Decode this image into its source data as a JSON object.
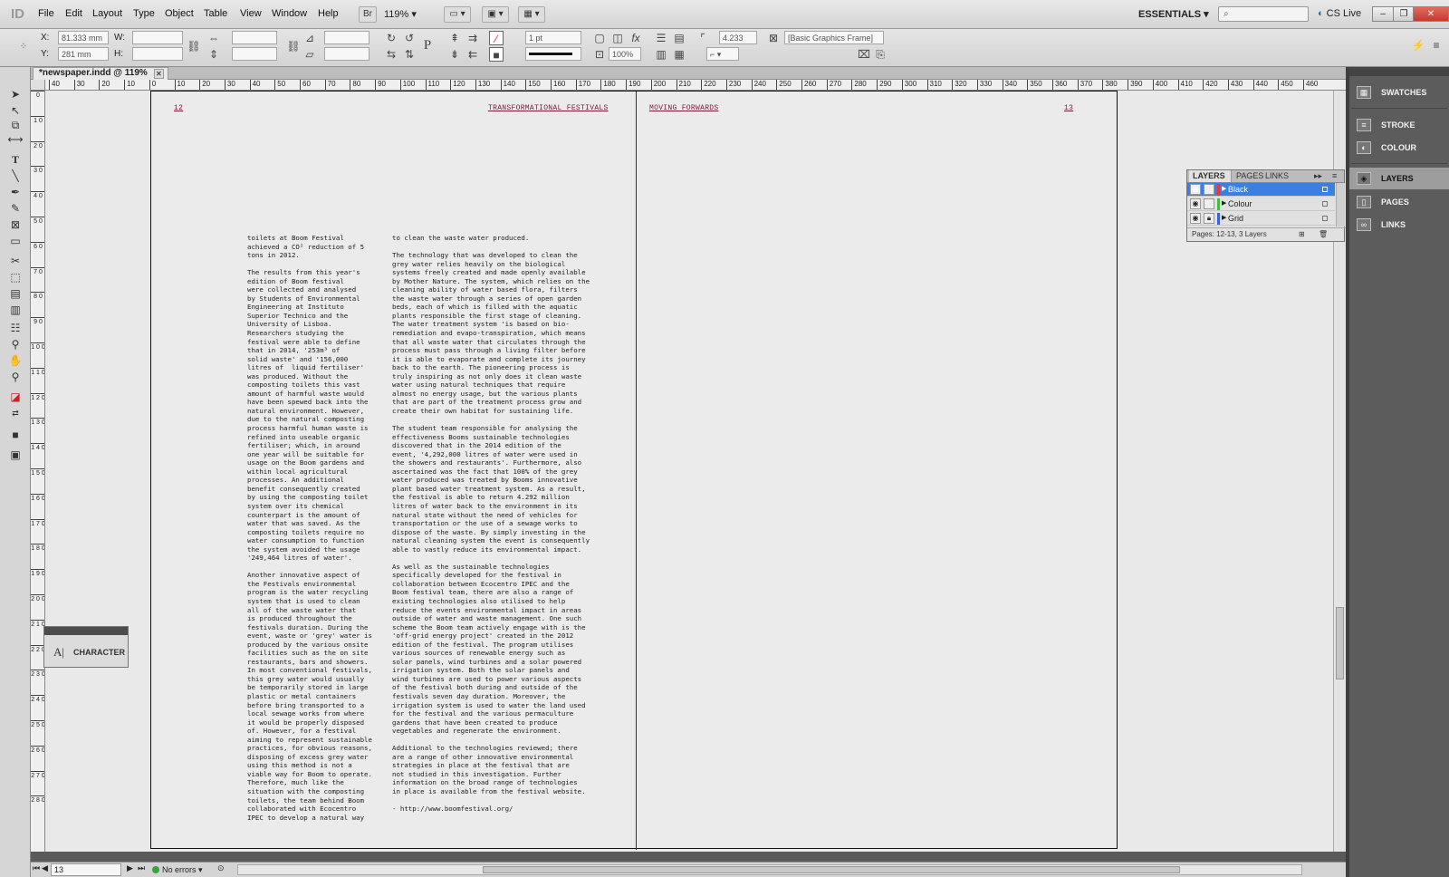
{
  "app": {
    "logo": "ID"
  },
  "menu": {
    "items": [
      "File",
      "Edit",
      "Layout",
      "Type",
      "Object",
      "Table",
      "View",
      "Window",
      "Help"
    ],
    "bridge_label": "Br",
    "zoom": "119%",
    "workspace": "ESSENTIALS",
    "cslive": "CS Live"
  },
  "control": {
    "x_label": "X:",
    "x_value": "81.333 mm",
    "y_label": "Y:",
    "y_value": "281 mm",
    "w_label": "W:",
    "h_label": "H:",
    "stroke_weight": "1 pt",
    "opacity": "100%",
    "ref_value": "4.233 mm",
    "object_style": "[Basic Graphics Frame]"
  },
  "document": {
    "tab_title": "*newspaper.indd @ 119%"
  },
  "ruler": {
    "h_labels": [
      "40",
      "30",
      "20",
      "10",
      "0",
      "10",
      "20",
      "30",
      "40",
      "50",
      "60",
      "70",
      "80",
      "90",
      "100",
      "110",
      "120",
      "130",
      "140",
      "150",
      "160",
      "170",
      "180",
      "190",
      "200",
      "210",
      "220",
      "230",
      "240",
      "250",
      "260",
      "270",
      "280",
      "290",
      "300",
      "310",
      "320",
      "330",
      "340",
      "350",
      "360",
      "370",
      "380",
      "390",
      "400",
      "410",
      "420",
      "430",
      "440",
      "450",
      "460"
    ],
    "v_labels": [
      "0",
      "1 0",
      "2 0",
      "3 0",
      "4 0",
      "5 0",
      "6 0",
      "7 0",
      "8 0",
      "9 0",
      "1 0 0",
      "1 1 0",
      "1 2 0",
      "1 3 0",
      "1 4 0",
      "1 5 0",
      "1 6 0",
      "1 7 0",
      "1 8 0",
      "1 9 0",
      "2 0 0",
      "2 1 0",
      "2 2 0",
      "2 3 0",
      "2 4 0",
      "2 5 0",
      "2 6 0",
      "2 7 0",
      "2 8 0"
    ]
  },
  "spread": {
    "left_folio": "12",
    "left_header": "TRANSFORMATIONAL FESTIVALS",
    "right_header": "MOVING FORWARDS",
    "right_folio": "13",
    "col1_text": "toilets at Boom Festival\nachieved a CO² reduction of 5\ntons in 2012.\n\nThe results from this year's\nedition of Boom festival\nwere collected and analysed\nby Students of Environmental\nEngineering at Instituto\nSuperior Technico and the\nUniversity of Lisboa.\nResearchers studying the\nfestival were able to define\nthat in 2014, '253m³ of\nsolid waste' and '156,000\nlitres of  liquid fertiliser'\nwas produced. Without the\ncomposting toilets this vast\namount of harmful waste would\nhave been spewed back into the\nnatural environment. However,\ndue to the natural composting\nprocess harmful human waste is\nrefined into useable organic\nfertiliser; which, in around\none year will be suitable for\nusage on the Boom gardens and\nwithin local agricultural\nprocesses. An additional\nbenefit consequently created\nby using the composting toilet\nsystem over its chemical\ncounterpart is the amount of\nwater that was saved. As the\ncomposting toilets require no\nwater consumption to function\nthe system avoided the usage\n'249,464 litres of water'.\n\nAnother innovative aspect of\nthe Festivals environmental\nprogram is the water recycling\nsystem that is used to clean\nall of the waste water that\nis produced throughout the\nfestivals duration. During the\nevent, waste or 'grey' water is\nproduced by the various onsite\nfacilities such as the on site\nrestaurants, bars and showers.\nIn most conventional festivals,\nthis grey water would usually\nbe temporarily stored in large\nplastic or metal containers\nbefore bring transported to a\nlocal sewage works from where\nit would be properly disposed\nof. However, for a festival\naiming to represent sustainable\npractices, for obvious reasons,\ndisposing of excess grey water\nusing this method is not a\nviable way for Boom to operate.\nTherefore, much like the\nsituation with the composting\ntoilets, the team behind Boom\ncollaborated with Ecocentro\nIPEC to develop a natural way",
    "col2_text": "to clean the waste water produced.\n\nThe technology that was developed to clean the\ngrey water relies heavily on the biological\nsystems freely created and made openly available\nby Mother Nature. The system, which relies on the\ncleaning ability of water based flora, filters\nthe waste water through a series of open garden\nbeds, each of which is filled with the aquatic\nplants responsible the first stage of cleaning.\nThe water treatment system 'is based on bio-\nremediation and evapo-transpiration, which means\nthat all waste water that circulates through the\nprocess must pass through a living filter before\nit is able to evaporate and complete its journey\nback to the earth. The pioneering process is\ntruly inspiring as not only does it clean waste\nwater using natural techniques that require\nalmost no energy usage, but the various plants\nthat are part of the treatment process grow and\ncreate their own habitat for sustaining life.\n\nThe student team responsible for analysing the\neffectiveness Booms sustainable technologies\ndiscovered that in the 2014 edition of the\nevent, '4,292,000 litres of water were used in\nthe showers and restaurants'. Furthermore, also\nascertained was the fact that 100% of the grey\nwater produced was treated by Booms innovative\nplant based water treatment system. As a result,\nthe festival is able to return 4.292 million\nlitres of water back to the environment in its\nnatural state without the need of vehicles for\ntransportation or the use of a sewage works to\ndispose of the waste. By simply investing in the\nnatural cleaning system the event is consequently\nable to vastly reduce its environmental impact.\n\nAs well as the sustainable technologies\nspecifically developed for the festival in\ncollaboration between Ecocentro IPEC and the\nBoom festival team, there are also a range of\nexisting technologies also utilised to help\nreduce the events environmental impact in areas\noutside of water and waste management. One such\nscheme the Boom team actively engage with is the\n'off-grid energy project' created in the 2012\nedition of the festival. The program utilises\nvarious sources of renewable energy such as\nsolar panels, wind turbines and a solar powered\nirrigation system. Both the solar panels and\nwind turbines are used to power various aspects\nof the festival both during and outside of the\nfestivals seven day duration. Moreover, the\nirrigation system is used to water the land used\nfor the festival and the various permaculture\ngardens that have been created to produce\nvegetables and regenerate the environment.\n\nAdditional to the technologies reviewed; there\nare a range of other innovative environmental\nstrategies in place at the festival that are\nnot studied in this investigation. Further\ninformation on the broad range of technologies\nin place is available from the festival website.\n\n- http://www.boomfestival.org/"
  },
  "character_panel": {
    "label": "CHARACTER"
  },
  "layers_panel": {
    "tabs": [
      "LAYERS",
      "PAGES",
      "LINKS"
    ],
    "layers": [
      {
        "name": "Black",
        "color": "#e23b3b"
      },
      {
        "name": "Colour",
        "color": "#3ec23e"
      },
      {
        "name": "Grid",
        "color": "#3b63d6"
      }
    ],
    "footer": "Pages: 12-13, 3 Layers"
  },
  "dock": {
    "items": [
      "SWATCHES",
      "STROKE",
      "COLOUR",
      "LAYERS",
      "PAGES",
      "LINKS"
    ]
  },
  "status": {
    "page": "13",
    "preflight": "No errors"
  },
  "colors": {
    "guide": "#2fb4b4",
    "margin": "#a95ab0",
    "selection": "#3b7fe0"
  }
}
